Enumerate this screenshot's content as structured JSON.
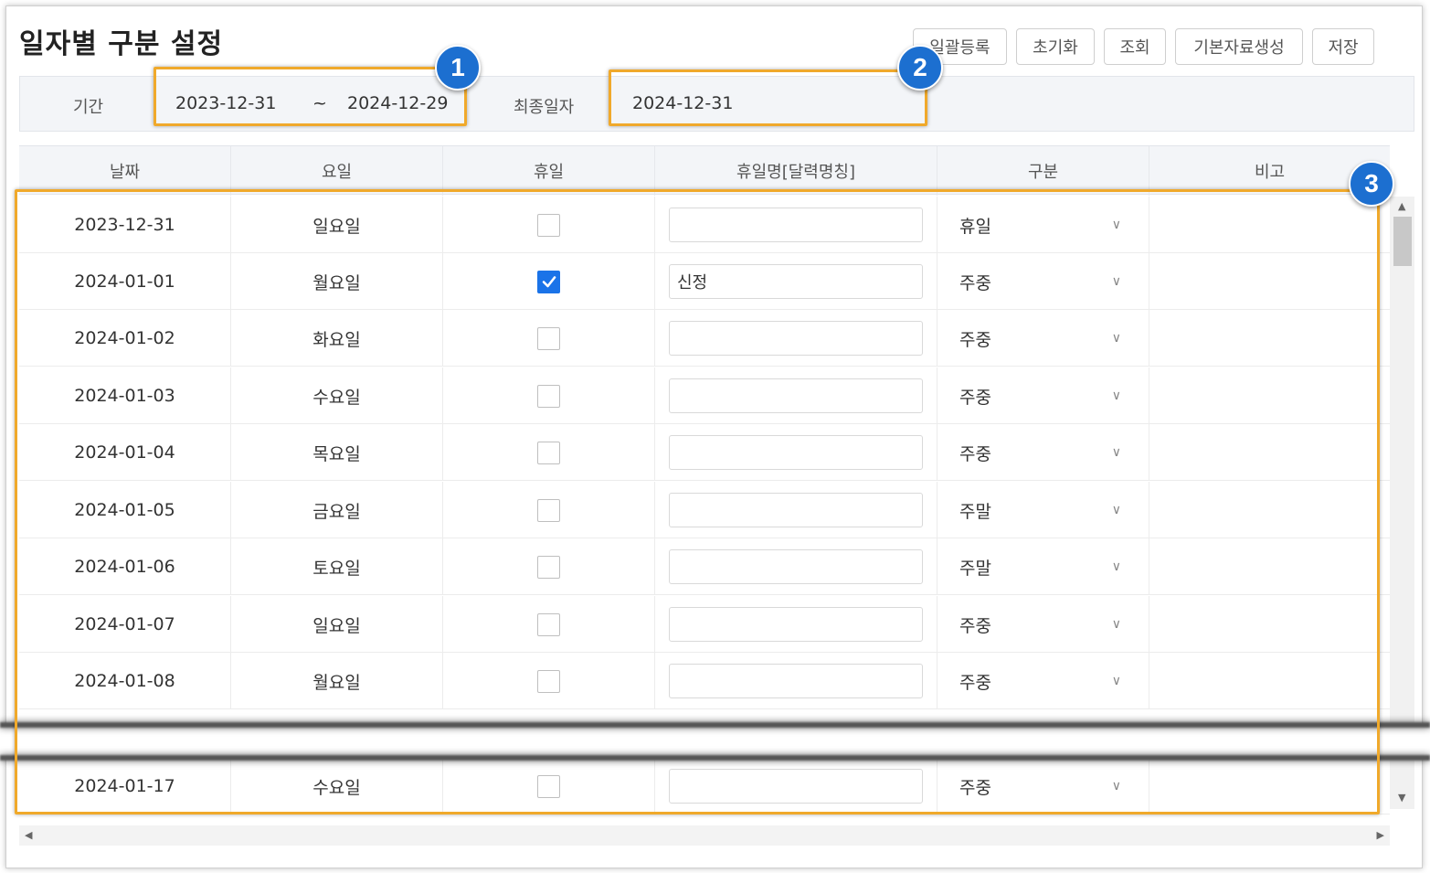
{
  "page": {
    "title": "일자별 구분 설정"
  },
  "toolbar": {
    "bulk_register": "일괄등록",
    "reset": "초기화",
    "search": "조회",
    "generate_base": "기본자료생성",
    "save": "저장"
  },
  "filter": {
    "period_label": "기간",
    "start_date": "2023-12-31",
    "separator": "~",
    "end_date": "2024-12-29",
    "final_date_label": "최종일자",
    "final_date": "2024-12-31"
  },
  "grid": {
    "columns": [
      "날짜",
      "요일",
      "휴일",
      "휴일명[달력명칭]",
      "구분",
      "비고"
    ],
    "rows": [
      {
        "date": "2023-12-31",
        "day": "일요일",
        "holiday": false,
        "holiday_name": "",
        "type": "휴일",
        "note": ""
      },
      {
        "date": "2024-01-01",
        "day": "월요일",
        "holiday": true,
        "holiday_name": "신정",
        "type": "주중",
        "note": ""
      },
      {
        "date": "2024-01-02",
        "day": "화요일",
        "holiday": false,
        "holiday_name": "",
        "type": "주중",
        "note": ""
      },
      {
        "date": "2024-01-03",
        "day": "수요일",
        "holiday": false,
        "holiday_name": "",
        "type": "주중",
        "note": ""
      },
      {
        "date": "2024-01-04",
        "day": "목요일",
        "holiday": false,
        "holiday_name": "",
        "type": "주중",
        "note": ""
      },
      {
        "date": "2024-01-05",
        "day": "금요일",
        "holiday": false,
        "holiday_name": "",
        "type": "주말",
        "note": ""
      },
      {
        "date": "2024-01-06",
        "day": "토요일",
        "holiday": false,
        "holiday_name": "",
        "type": "주말",
        "note": ""
      },
      {
        "date": "2024-01-07",
        "day": "일요일",
        "holiday": false,
        "holiday_name": "",
        "type": "주중",
        "note": ""
      },
      {
        "date": "2024-01-08",
        "day": "월요일",
        "holiday": false,
        "holiday_name": "",
        "type": "주중",
        "note": ""
      },
      {
        "date": "2024-01-17",
        "day": "수요일",
        "holiday": false,
        "holiday_name": "",
        "type": "주중",
        "note": ""
      }
    ]
  },
  "callouts": [
    "1",
    "2",
    "3"
  ],
  "colors": {
    "highlight": "#f0a92b",
    "badge": "#1c6fd0",
    "checkbox_on": "#1a73e8"
  }
}
